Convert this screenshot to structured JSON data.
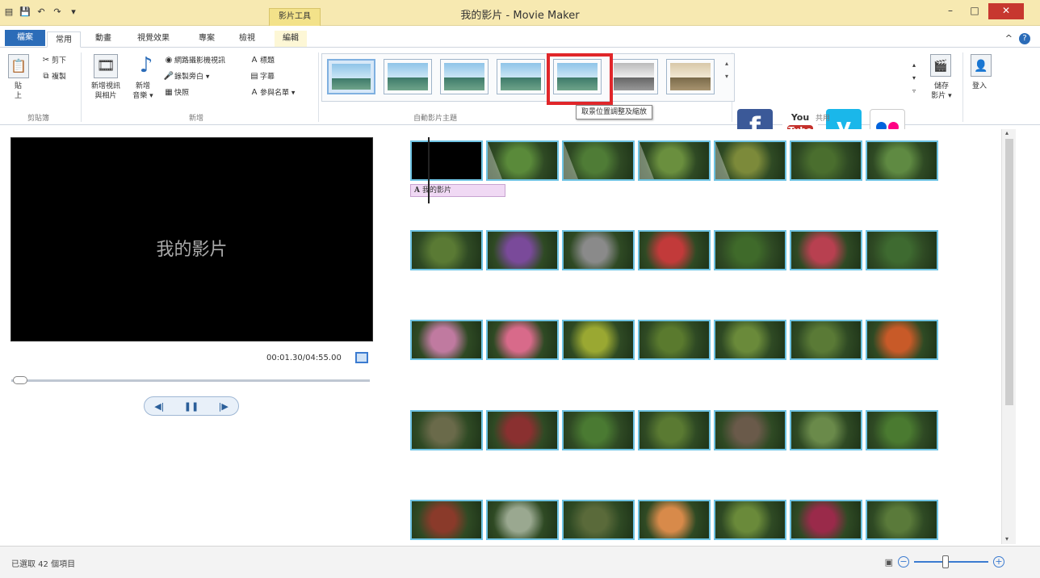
{
  "titlebar": {
    "title": "我的影片 - Movie Maker",
    "context_tab": "影片工具",
    "minimize": "–",
    "maximize": "□",
    "close": "✕"
  },
  "tabs": {
    "file": "檔案",
    "home": "常用",
    "animations": "動畫",
    "visual_effects": "視覺效果",
    "project": "專案",
    "view": "檢視",
    "edit": "編輯"
  },
  "ribbon": {
    "clipboard": {
      "paste_line1": "貼",
      "paste_line2": "上",
      "cut": "剪下",
      "copy": "複製",
      "group_label": "剪貼簿"
    },
    "add": {
      "add_videos_line1": "新增視訊",
      "add_videos_line2": "與相片",
      "add_music_line1": "新增",
      "add_music_line2": "音樂 ▾",
      "webcam": "網路攝影機視訊",
      "record_narration": "錄製旁白 ▾",
      "snapshot": "快照",
      "title": "標題",
      "caption": "字幕",
      "credits": "參與名單 ▾",
      "group_label": "新增"
    },
    "themes_group_label": "自動影片主題",
    "tooltip": "取景位置調整及縮放",
    "share": {
      "youtube_you": "You",
      "youtube_tube": "Tube",
      "save_movie_line1": "儲存",
      "save_movie_line2": "影片 ▾",
      "sign_in": "登入",
      "group_label": "共用"
    }
  },
  "preview": {
    "title_text": "我的影片",
    "time": "00:01.30/04:55.00"
  },
  "storyboard": {
    "caption": "我的影片",
    "rows": [
      {
        "clips": [
          "black",
          "#5a8a3a",
          "#4f7c36",
          "#6a8f3e",
          "#7c8a3a",
          "#4a6e2e",
          "#5f8a42"
        ]
      },
      {
        "clips": [
          "#5a7a34",
          "#7a4a9a",
          "#8a8a8a",
          "#c23a3a",
          "#3f6a2a",
          "#b84050",
          "#3e6a30"
        ]
      },
      {
        "clips": [
          "#c07aa0",
          "#d86a8a",
          "#9aa832",
          "#5a7a2e",
          "#6a8a3a",
          "#5a7a36",
          "#c85a28"
        ]
      },
      {
        "clips": [
          "#6a6a4a",
          "#8a3030",
          "#4a7a32",
          "#5a7a32",
          "#6a5a4a",
          "#6a8a4a",
          "#4a7a30"
        ]
      },
      {
        "clips": [
          "#8a3a2a",
          "#9aa890",
          "#5a6a3a",
          "#d88a4a",
          "#6a8a3a",
          "#9a2a4a",
          "#5a7a3a"
        ]
      }
    ]
  },
  "status": {
    "text": "已選取 42 個項目"
  },
  "zoom": {
    "minus": "−",
    "plus": "+",
    "level": 0.42
  }
}
